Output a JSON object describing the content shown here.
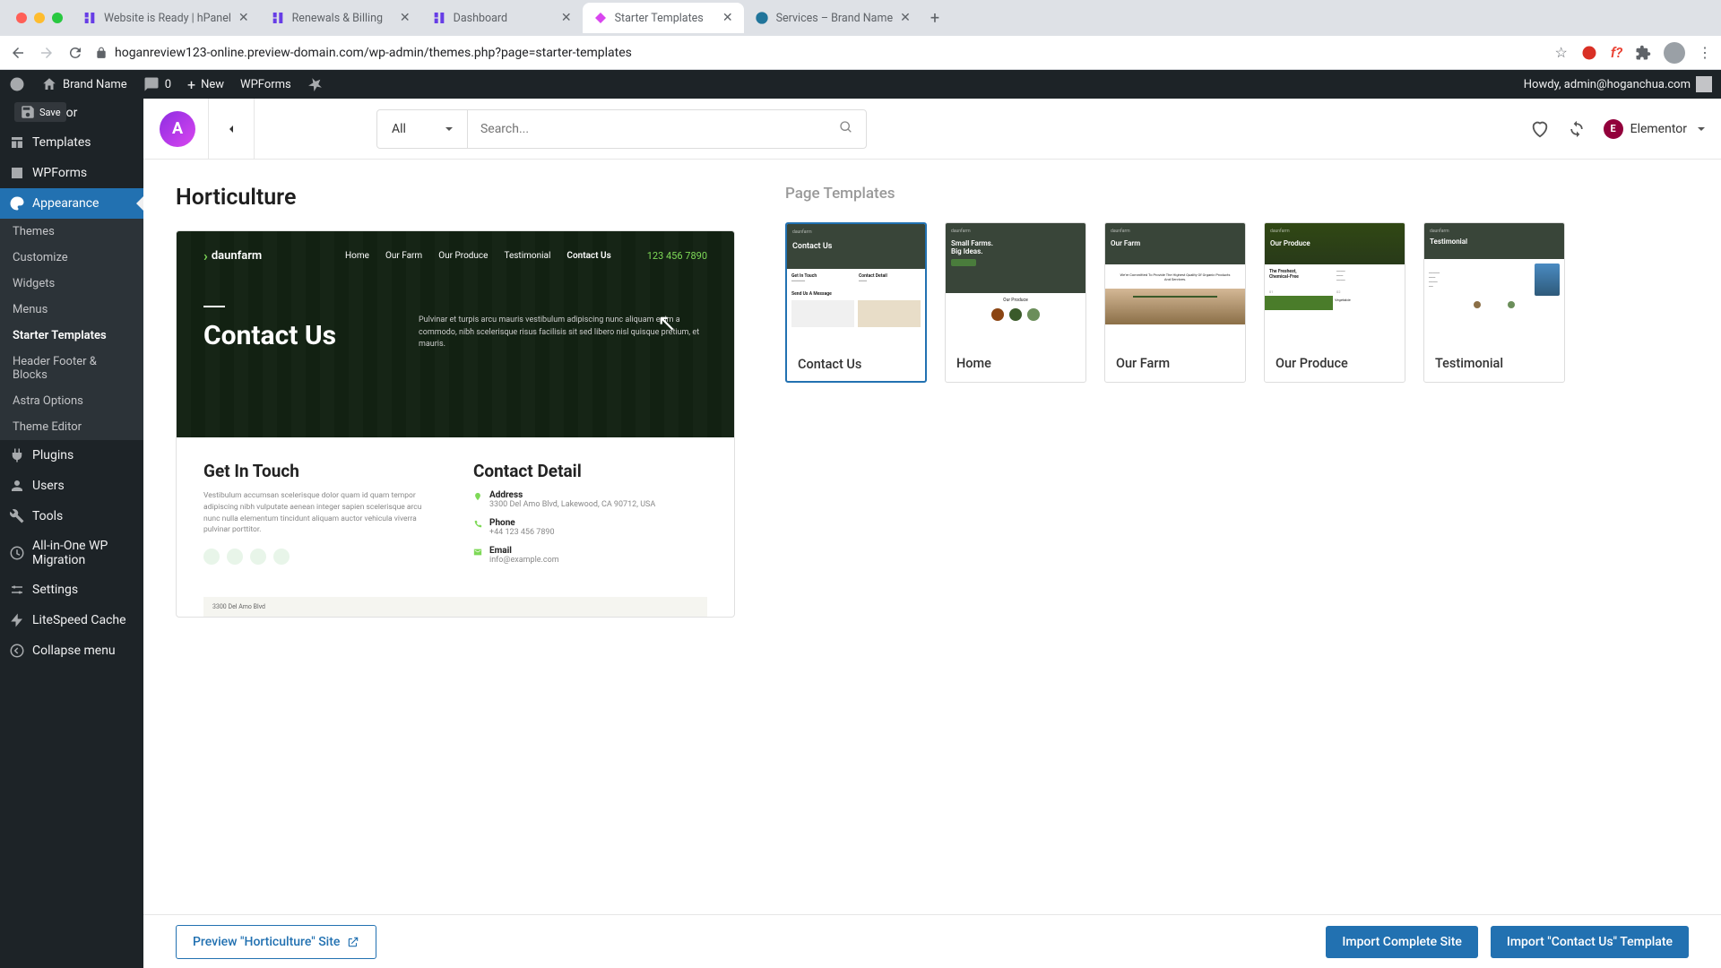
{
  "browser": {
    "tabs": [
      {
        "title": "Website is Ready | hPanel",
        "active": false
      },
      {
        "title": "Renewals & Billing",
        "active": false
      },
      {
        "title": "Dashboard",
        "active": false
      },
      {
        "title": "Starter Templates",
        "active": true
      },
      {
        "title": "Services – Brand Name",
        "active": false
      }
    ],
    "url": "hoganreview123-online.preview-domain.com/wp-admin/themes.php?page=starter-templates"
  },
  "wp_adminbar": {
    "site_name": "Brand Name",
    "comments": "0",
    "new_label": "New",
    "wpforms_label": "WPForms",
    "howdy": "Howdy, admin@hoganchua.com"
  },
  "sidebar": {
    "save_label": "Save",
    "items": [
      {
        "label": "entor",
        "icon": "elementor"
      },
      {
        "label": "Templates",
        "icon": "templates"
      },
      {
        "label": "WPForms",
        "icon": "wpforms"
      },
      {
        "label": "Appearance",
        "icon": "appearance",
        "current": true
      },
      {
        "label": "Plugins",
        "icon": "plugins"
      },
      {
        "label": "Users",
        "icon": "users"
      },
      {
        "label": "Tools",
        "icon": "tools"
      },
      {
        "label": "All-in-One WP Migration",
        "icon": "migration"
      },
      {
        "label": "Settings",
        "icon": "settings"
      },
      {
        "label": "LiteSpeed Cache",
        "icon": "litespeed"
      },
      {
        "label": "Collapse menu",
        "icon": "collapse"
      }
    ],
    "submenu": [
      {
        "label": "Themes"
      },
      {
        "label": "Customize"
      },
      {
        "label": "Widgets"
      },
      {
        "label": "Menus"
      },
      {
        "label": "Starter Templates",
        "current": true
      },
      {
        "label": "Header Footer & Blocks"
      },
      {
        "label": "Astra Options"
      },
      {
        "label": "Theme Editor"
      }
    ]
  },
  "st_header": {
    "filter": "All",
    "search_placeholder": "Search...",
    "builder": "Elementor"
  },
  "content": {
    "title": "Horticulture",
    "section_title": "Page Templates",
    "preview": {
      "brand": "daunfarm",
      "nav": [
        "Home",
        "Our Farm",
        "Our Produce",
        "Testimonial",
        "Contact Us"
      ],
      "phone": "123 456 7890",
      "h1": "Contact Us",
      "hero_text": "Pulvinar et turpis arcu mauris vestibulum adipiscing nunc aliquam enim a commodo, nibh scelerisque risus facilisis sit sed libero nisl quisque pretium, et mauris.",
      "get_in_touch": "Get In Touch",
      "get_in_touch_text": "Vestibulum accumsan scelerisque dolor quam id quam tempor adipiscing nibh vulputate aenean integer sapien scelerisque arcu nunc nulla elementum tincidunt aliquam auctor vehicula viverra pulvinar porttitor.",
      "contact_detail": "Contact Detail",
      "address_label": "Address",
      "address_val": "3300 Del Amo Blvd, Lakewood, CA 90712, USA",
      "phone_label": "Phone",
      "phone_val": "+44 123 456 7890",
      "email_label": "Email",
      "email_val": "info@example.com",
      "map_text": "3300 Del Amo Blvd"
    },
    "templates": [
      {
        "label": "Contact Us",
        "selected": true
      },
      {
        "label": "Home"
      },
      {
        "label": "Our Farm"
      },
      {
        "label": "Our Produce"
      },
      {
        "label": "Testimonial"
      }
    ]
  },
  "footer": {
    "preview_btn": "Preview \"Horticulture\" Site",
    "import_site": "Import Complete Site",
    "import_tmpl": "Import \"Contact Us\" Template"
  }
}
